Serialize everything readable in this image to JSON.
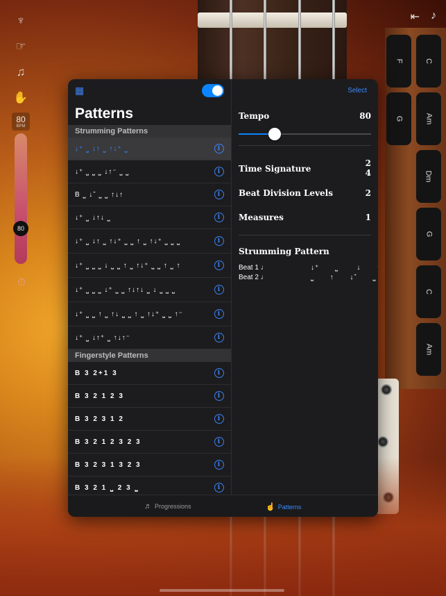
{
  "left_tools": {
    "icons": [
      "tuning-forks-icon",
      "hand-pointer-icon",
      "music-list-icon",
      "hand-icon"
    ],
    "bpm_value": "80",
    "bpm_unit": "BPM",
    "tempo_knob_value": "80",
    "metronome_icon": "metronome-icon"
  },
  "top_right": {
    "icons": [
      "exit-icon",
      "music-note-icon"
    ]
  },
  "chords": {
    "column_left": [
      "F",
      "G"
    ],
    "column_right": [
      "C",
      "Am",
      "Dm",
      "G",
      "C",
      "Am"
    ]
  },
  "patterns_pane": {
    "title": "Patterns",
    "toggle_on": true,
    "strumming_header": "Strumming Patterns",
    "strumming_rows": [
      "↓⁺ ⎵ ↓↑ ⎵ ↑↓⁺ ⎵",
      "↓⁺ ⎵ ⎵ ⎵ ↓↑⁻ ⎵ ⎵",
      "B ⎵ ↓⁺ ⎵ ⎵ ↑↓↑",
      "↓⁺ ⎵ ↓↑↓ ⎵",
      "↓⁺ ⎵ ↓↑ ⎵ ↑↓⁺ ⎵ ⎵ ↑ ⎵ ↑↓⁺ ⎵ ⎵ ⎵",
      "↓⁺ ⎵ ⎵ ⎵ ↓ ⎵ ⎵ ↑ ⎵ ↑↓⁺ ⎵ ⎵ ↑ ⎵ ↑",
      "↓⁺ ⎵ ⎵ ⎵ ↓⁺ ⎵ ⎵ ↑↓↑↓ ⎵ ↓ ⎵ ⎵ ⎵",
      "↓⁺ ⎵ ⎵ ↑ ⎵ ↑↓ ⎵ ⎵ ↑ ⎵ ↑↓⁺ ⎵ ⎵ ↑⁻",
      "↓⁺ ⎵ ↓↑⁺ ⎵ ↑↓↑⁻"
    ],
    "fingerstyle_header": "Fingerstyle Patterns",
    "fingerstyle_rows": [
      "B 3 2+1 3",
      "B 3 2 1 2 3",
      "B 3 2 3 1 2",
      "B 3 2 1 2 3 2 3",
      "B 3 2 3 1 3 2 3",
      "B 3 2 1 ⎵ 2 3 ⎵"
    ]
  },
  "settings_pane": {
    "select_label": "Select",
    "tempo_label": "Tempo",
    "tempo_value": "80",
    "tempo_fraction": 0.27,
    "time_signature_label": "Time Signature",
    "time_signature_top": "2",
    "time_signature_bottom": "4",
    "beat_division_label": "Beat Division Levels",
    "beat_division_value": "2",
    "measures_label": "Measures",
    "measures_value": "1",
    "strumming_pattern_label": "Strumming Pattern",
    "beat1_label": "Beat 1 ♩",
    "beat1_notes": "↓⁺      ⎵       ↓      ↑",
    "beat2_label": "Beat 2 ♩",
    "beat2_notes": "⎵      ↑      ↓⁺      ⎵"
  },
  "tabbar": {
    "progressions_label": "Progressions",
    "patterns_label": "Patterns",
    "active": "patterns"
  },
  "colors": {
    "accent": "#0a84ff",
    "panel": "#1c1c1e",
    "header": "#333336"
  }
}
